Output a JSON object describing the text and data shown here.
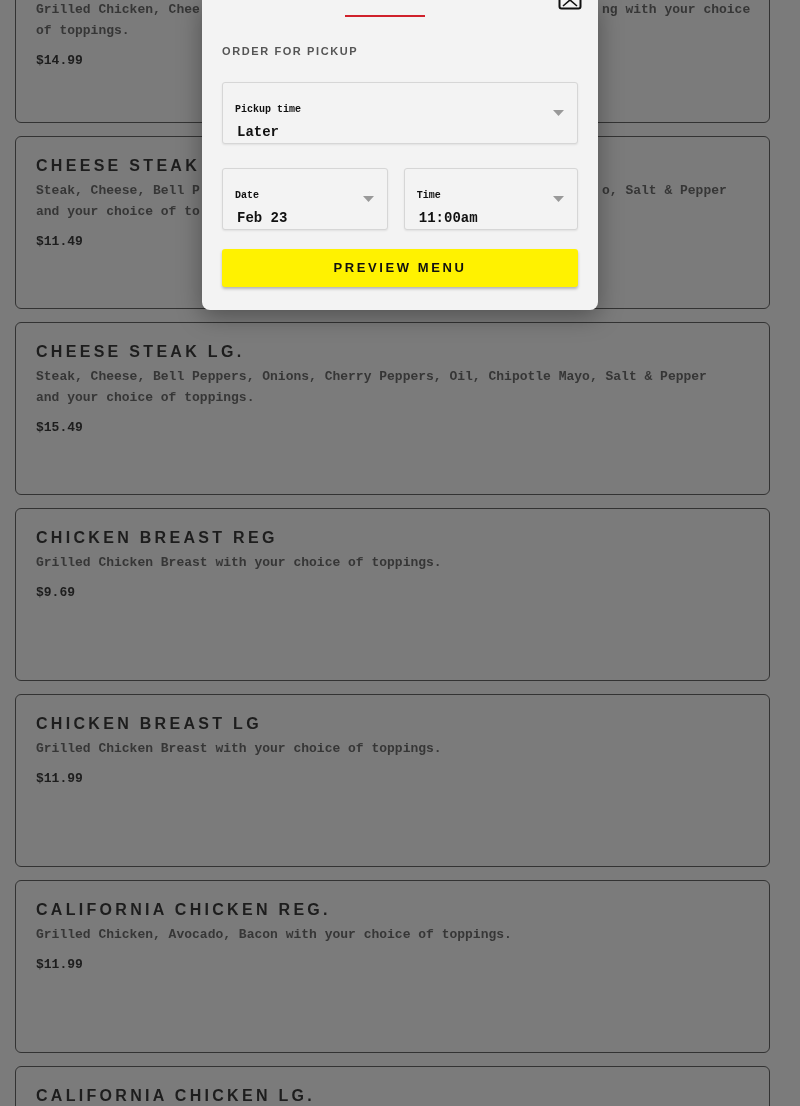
{
  "menu_items": [
    {
      "description": [
        {
          "text": "Grilled Chicken, Chee",
          "right": "ng with your choice"
        },
        {
          "text": "of toppings."
        }
      ],
      "price": "$14.99"
    },
    {
      "title": "CHEESE STEAK",
      "description": [
        {
          "text": "Steak, Cheese, Bell P",
          "right": "o, Salt & Pepper"
        },
        {
          "text": "and your choice of to"
        }
      ],
      "price": "$11.49"
    },
    {
      "title": "CHEESE STEAK LG.",
      "description": [
        {
          "text": "Steak, Cheese, Bell Peppers, Onions, Cherry Peppers, Oil, Chipotle Mayo, Salt & Pepper"
        },
        {
          "text": "and your choice of toppings."
        }
      ],
      "price": "$15.49"
    },
    {
      "title": "CHICKEN BREAST REG",
      "description": [
        {
          "text": "Grilled Chicken Breast with your choice of toppings."
        }
      ],
      "price": "$9.69"
    },
    {
      "title": "CHICKEN BREAST LG",
      "description": [
        {
          "text": "Grilled Chicken Breast with your choice of toppings."
        }
      ],
      "price": "$11.99"
    },
    {
      "title": "CALIFORNIA CHICKEN REG.",
      "description": [
        {
          "text": "Grilled Chicken, Avocado, Bacon with your choice of toppings."
        }
      ],
      "price": "$11.99"
    },
    {
      "title": "CALIFORNIA CHICKEN LG."
    }
  ],
  "modal": {
    "heading": "ORDER FOR PICKUP",
    "fields": [
      {
        "label": "Pickup time",
        "value": "Later"
      },
      {
        "label": "Date",
        "value": "Feb 23"
      },
      {
        "label": "Time",
        "value": "11:00am"
      }
    ],
    "button": "PREVIEW MENU"
  }
}
